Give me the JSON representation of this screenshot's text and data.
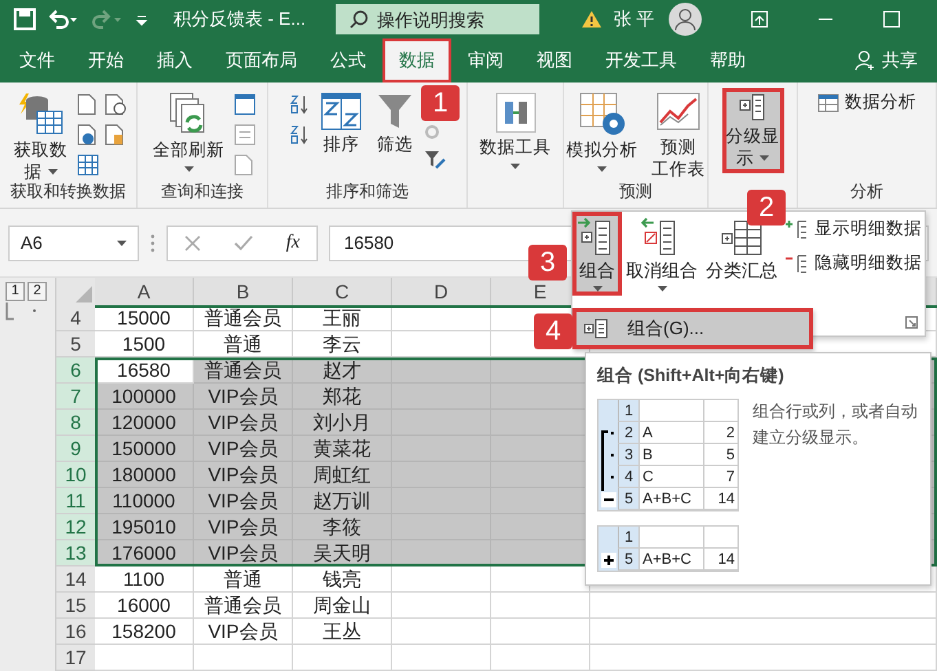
{
  "title_bar": {
    "title": "积分反馈表  -  E...",
    "search_placeholder": "操作说明搜索",
    "user": "张 平"
  },
  "tabs": [
    {
      "label": "文件",
      "selected": false,
      "highlighted": false
    },
    {
      "label": "开始",
      "selected": false,
      "highlighted": false
    },
    {
      "label": "插入",
      "selected": false,
      "highlighted": false
    },
    {
      "label": "页面布局",
      "selected": false,
      "highlighted": false
    },
    {
      "label": "公式",
      "selected": false,
      "highlighted": false
    },
    {
      "label": "数据",
      "selected": true,
      "highlighted": true
    },
    {
      "label": "审阅",
      "selected": false,
      "highlighted": false
    },
    {
      "label": "视图",
      "selected": false,
      "highlighted": false
    },
    {
      "label": "开发工具",
      "selected": false,
      "highlighted": false
    },
    {
      "label": "帮助",
      "selected": false,
      "highlighted": false
    }
  ],
  "share": "共享",
  "ribbon_groups": [
    {
      "label": "获取和转换数据",
      "buttons": [
        {
          "lines": [
            "获取数",
            "据"
          ],
          "dropdown": true,
          "selected": false,
          "highlighted": false
        }
      ]
    },
    {
      "label": "查询和连接",
      "buttons": [
        {
          "lines": [
            "全部刷新"
          ],
          "dropdown": true,
          "selected": false,
          "highlighted": false
        }
      ]
    },
    {
      "label": "排序和筛选",
      "buttons": [
        {
          "lines": [
            "排序"
          ],
          "dropdown": false,
          "selected": false,
          "highlighted": false
        },
        {
          "lines": [
            "筛选"
          ],
          "dropdown": false,
          "selected": false,
          "highlighted": false
        }
      ]
    },
    {
      "buttons": [
        {
          "lines": [
            "数据工具"
          ],
          "dropdown": true,
          "selected": false,
          "highlighted": false
        }
      ]
    },
    {
      "label": "预测",
      "buttons": [
        {
          "lines": [
            "模拟分析"
          ],
          "dropdown": true,
          "selected": false,
          "highlighted": false
        },
        {
          "lines": [
            "预测",
            "工作表"
          ],
          "dropdown": false,
          "selected": false,
          "highlighted": false
        }
      ]
    },
    {
      "buttons": [
        {
          "lines": [
            "分级显",
            "示"
          ],
          "dropdown": true,
          "selected": true,
          "highlighted": true
        }
      ]
    },
    {
      "label": "分析",
      "buttons": [
        {
          "lines": [
            "数据分析"
          ],
          "dropdown": false,
          "selected": false,
          "highlighted": false
        }
      ]
    }
  ],
  "name_box": "A6",
  "function_label": "fx",
  "formula": "16580",
  "outline_levels": [
    "1",
    "2"
  ],
  "columns": [
    "A",
    "B",
    "C",
    "D",
    "E"
  ],
  "rows": [
    {
      "num": "4",
      "cells": [
        "15000",
        "普通会员",
        "王丽"
      ],
      "selected": false
    },
    {
      "num": "5",
      "cells": [
        "1500",
        "普通",
        "李云"
      ],
      "selected": false
    },
    {
      "num": "6",
      "cells": [
        "16580",
        "普通会员",
        "赵才"
      ],
      "selected": true
    },
    {
      "num": "7",
      "cells": [
        "100000",
        "VIP会员",
        "郑花"
      ],
      "selected": true
    },
    {
      "num": "8",
      "cells": [
        "120000",
        "VIP会员",
        "刘小月"
      ],
      "selected": true
    },
    {
      "num": "9",
      "cells": [
        "150000",
        "VIP会员",
        "黄菜花"
      ],
      "selected": true
    },
    {
      "num": "10",
      "cells": [
        "180000",
        "VIP会员",
        "周虹红"
      ],
      "selected": true
    },
    {
      "num": "11",
      "cells": [
        "110000",
        "VIP会员",
        "赵万训"
      ],
      "selected": true
    },
    {
      "num": "12",
      "cells": [
        "195010",
        "VIP会员",
        "李筱"
      ],
      "selected": true
    },
    {
      "num": "13",
      "cells": [
        "176000",
        "VIP会员",
        "吴天明"
      ],
      "selected": true
    },
    {
      "num": "14",
      "cells": [
        "1100",
        "普通",
        "钱亮"
      ],
      "selected": false
    },
    {
      "num": "15",
      "cells": [
        "16000",
        "普通会员",
        "周金山"
      ],
      "selected": false
    },
    {
      "num": "16",
      "cells": [
        "158200",
        "VIP会员",
        "王丛"
      ],
      "selected": false
    },
    {
      "num": "17",
      "cells": [],
      "selected": false
    }
  ],
  "outline_panel": {
    "buttons": [
      {
        "lines": [
          "组合"
        ],
        "dropdown": true,
        "selected": true,
        "highlighted": true
      },
      {
        "lines": [
          "取消组合"
        ],
        "dropdown": true,
        "selected": false,
        "highlighted": false
      },
      {
        "lines": [
          "分类汇总"
        ],
        "dropdown": false,
        "selected": false,
        "highlighted": false
      }
    ],
    "small_buttons": [
      "显示明细数据",
      "隐藏明细数据"
    ]
  },
  "menu": [
    {
      "label": "组合(G)...",
      "highlighted": true
    }
  ],
  "tooltip": {
    "title": "组合 (Shift+Alt+向右键)",
    "description": "组合行或列，或者自动建立分级显示。",
    "expanded": [
      {
        "row": "1"
      },
      {
        "row": "2",
        "label": "A",
        "value": "2"
      },
      {
        "row": "3",
        "label": "B",
        "value": "5"
      },
      {
        "row": "4",
        "label": "C",
        "value": "7"
      },
      {
        "row": "5",
        "label": "A+B+C",
        "value": "14"
      }
    ],
    "collapsed": [
      {
        "row": "1"
      },
      {
        "row": "5",
        "label": "A+B+C",
        "value": "14"
      }
    ]
  },
  "callouts": [
    "1",
    "2",
    "3",
    "4"
  ]
}
